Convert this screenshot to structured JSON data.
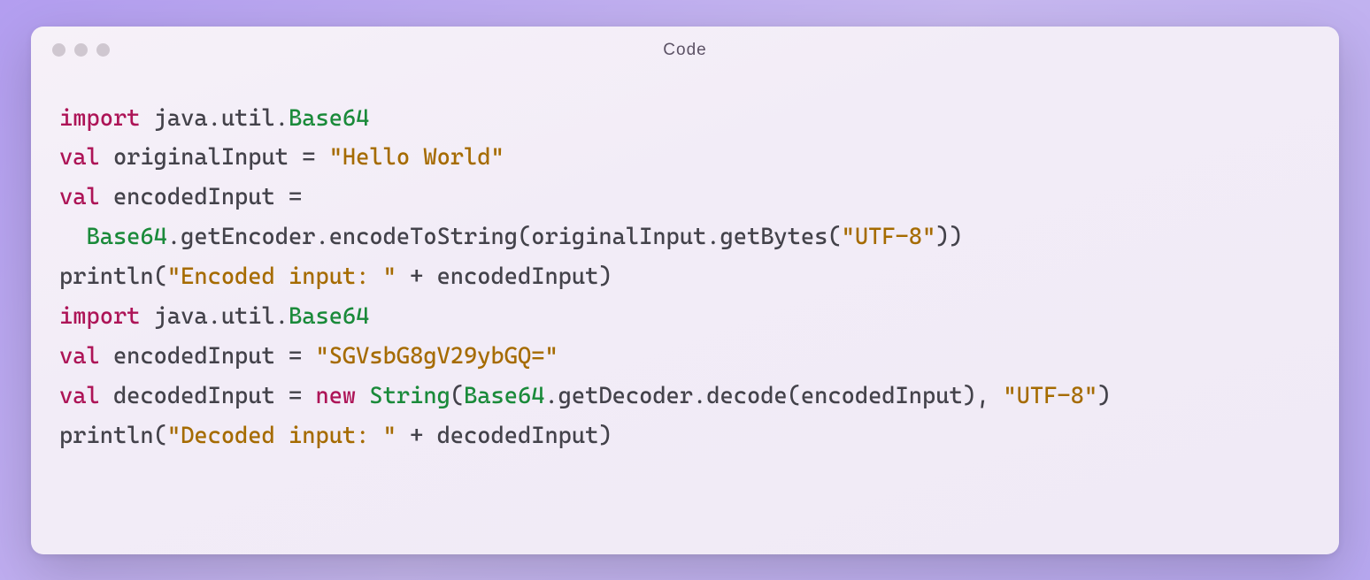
{
  "window": {
    "title": "Code"
  },
  "code": {
    "lines": [
      [
        {
          "cls": "tok-keyword",
          "text": "import"
        },
        {
          "cls": "tok-plain",
          "text": " java.util."
        },
        {
          "cls": "tok-type",
          "text": "Base64"
        }
      ],
      [
        {
          "cls": "tok-keyword",
          "text": "val"
        },
        {
          "cls": "tok-plain",
          "text": " originalInput = "
        },
        {
          "cls": "tok-string",
          "text": "\"Hello World\""
        }
      ],
      [
        {
          "cls": "tok-keyword",
          "text": "val"
        },
        {
          "cls": "tok-plain",
          "text": " encodedInput ="
        }
      ],
      [
        {
          "cls": "tok-plain",
          "text": "  "
        },
        {
          "cls": "tok-type",
          "text": "Base64"
        },
        {
          "cls": "tok-plain",
          "text": ".getEncoder.encodeToString(originalInput.getBytes("
        },
        {
          "cls": "tok-string",
          "text": "\"UTF-8\""
        },
        {
          "cls": "tok-plain",
          "text": "))"
        }
      ],
      [
        {
          "cls": "tok-plain",
          "text": "println("
        },
        {
          "cls": "tok-string",
          "text": "\"Encoded input: \""
        },
        {
          "cls": "tok-plain",
          "text": " + encodedInput)"
        }
      ],
      [
        {
          "cls": "tok-plain",
          "text": ""
        }
      ],
      [
        {
          "cls": "tok-keyword",
          "text": "import"
        },
        {
          "cls": "tok-plain",
          "text": " java.util."
        },
        {
          "cls": "tok-type",
          "text": "Base64"
        }
      ],
      [
        {
          "cls": "tok-keyword",
          "text": "val"
        },
        {
          "cls": "tok-plain",
          "text": " encodedInput = "
        },
        {
          "cls": "tok-string",
          "text": "\"SGVsbG8gV29ybGQ=\""
        }
      ],
      [
        {
          "cls": "tok-keyword",
          "text": "val"
        },
        {
          "cls": "tok-plain",
          "text": " decodedInput = "
        },
        {
          "cls": "tok-keyword",
          "text": "new"
        },
        {
          "cls": "tok-plain",
          "text": " "
        },
        {
          "cls": "tok-type",
          "text": "String"
        },
        {
          "cls": "tok-plain",
          "text": "("
        },
        {
          "cls": "tok-type",
          "text": "Base64"
        },
        {
          "cls": "tok-plain",
          "text": ".getDecoder.decode(encodedInput), "
        },
        {
          "cls": "tok-string",
          "text": "\"UTF-8\""
        },
        {
          "cls": "tok-plain",
          "text": ")"
        }
      ],
      [
        {
          "cls": "tok-plain",
          "text": "println("
        },
        {
          "cls": "tok-string",
          "text": "\"Decoded input: \""
        },
        {
          "cls": "tok-plain",
          "text": " + decodedInput)"
        }
      ]
    ]
  }
}
